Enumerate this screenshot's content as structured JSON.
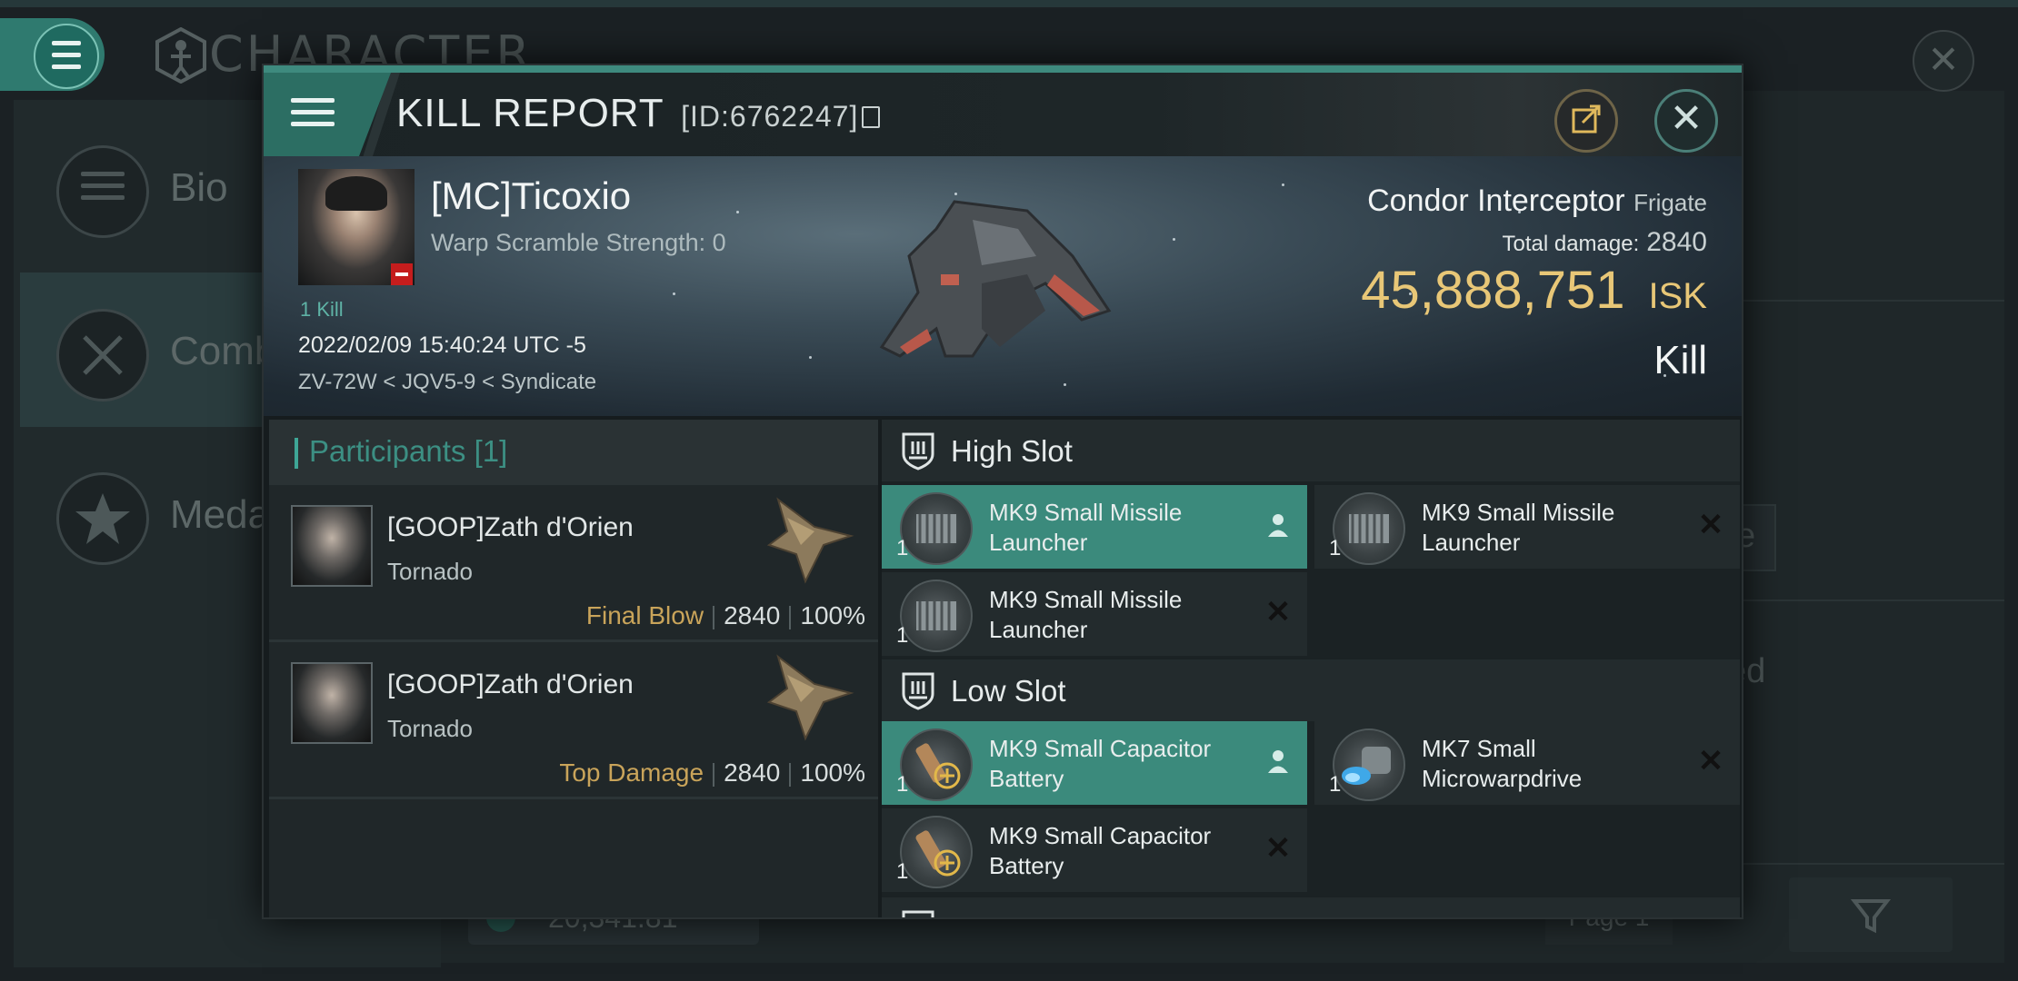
{
  "background": {
    "title": "CHARACTER",
    "tabs": [
      "Bio",
      "Comb",
      "Meda"
    ],
    "fragment_right_1": "e",
    "fragment_right_2": "ed",
    "bottom_value": "20,341.81",
    "page_label": "Page 1"
  },
  "report": {
    "title": "KILL REPORT",
    "id": "[ID:6762247]",
    "pilot_name": "[MC]Ticoxio",
    "warp_scramble": "Warp Scramble Strength: 0",
    "kill_count": "1 Kill",
    "datetime": "2022/02/09 15:40:24 UTC -5",
    "location": "ZV-72W < JQV5-9 < Syndicate",
    "ship_name": "Condor Interceptor",
    "ship_class": "Frigate",
    "total_damage_label": "Total damage:",
    "total_damage": "2840",
    "isk_value": "45,888,751",
    "isk_unit": "ISK",
    "result": "Kill"
  },
  "participants": {
    "header": "Participants [1]",
    "rows": [
      {
        "name": "[GOOP]Zath d'Orien",
        "ship": "Tornado",
        "tag": "Final Blow",
        "damage": "2840",
        "percent": "100%"
      },
      {
        "name": "[GOOP]Zath d'Orien",
        "ship": "Tornado",
        "tag": "Top Damage",
        "damage": "2840",
        "percent": "100%"
      }
    ]
  },
  "slots": {
    "high": {
      "label": "High Slot",
      "modules": [
        {
          "qty": "1",
          "name": "MK9 Small Missile Launcher",
          "status": "dropped"
        },
        {
          "qty": "1",
          "name": "MK9 Small Missile Launcher",
          "status": "destroyed"
        },
        {
          "qty": "1",
          "name": "MK9 Small Missile Launcher",
          "status": "destroyed"
        }
      ]
    },
    "low": {
      "label": "Low Slot",
      "modules": [
        {
          "qty": "1",
          "name": "MK9 Small Capacitor Battery",
          "status": "dropped"
        },
        {
          "qty": "1",
          "name": "MK7 Small Microwarpdrive",
          "status": "destroyed"
        },
        {
          "qty": "1",
          "name": "MK9 Small Capacitor Battery",
          "status": "destroyed"
        }
      ]
    }
  },
  "colors": {
    "accent": "#3b8a7c",
    "isk": "#e8c777",
    "tag": "#c9a45a",
    "badge": "#c51d1d"
  }
}
